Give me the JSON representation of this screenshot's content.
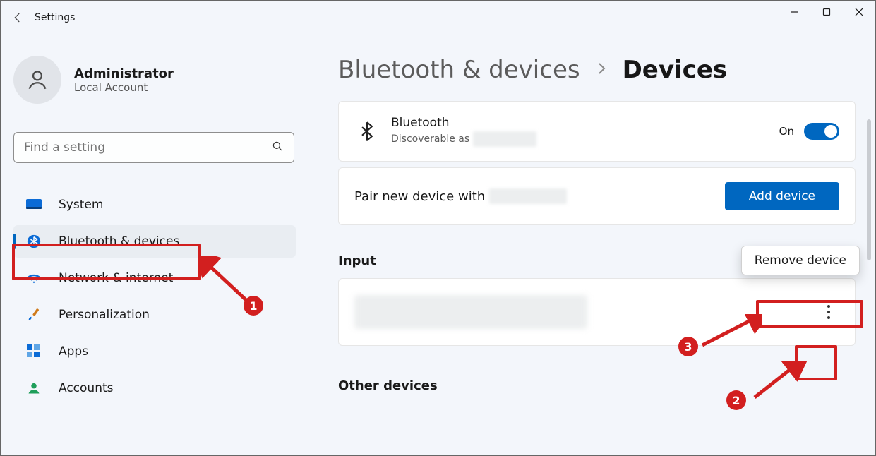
{
  "window": {
    "app_title": "Settings"
  },
  "account": {
    "name": "Administrator",
    "sub": "Local Account"
  },
  "search": {
    "placeholder": "Find a setting"
  },
  "nav": {
    "items": [
      {
        "label": "System"
      },
      {
        "label": "Bluetooth & devices"
      },
      {
        "label": "Network & internet"
      },
      {
        "label": "Personalization"
      },
      {
        "label": "Apps"
      },
      {
        "label": "Accounts"
      }
    ]
  },
  "breadcrumb": {
    "parent": "Bluetooth & devices",
    "current": "Devices"
  },
  "bluetooth": {
    "title": "Bluetooth",
    "subtitle_prefix": "Discoverable as ",
    "toggle_label": "On"
  },
  "pair": {
    "text_prefix": "Pair new device with ",
    "button": "Add device"
  },
  "sections": {
    "input_heading": "Input",
    "other_heading": "Other devices"
  },
  "context_menu": {
    "remove_label": "Remove device"
  },
  "annotations": {
    "badge1": "1",
    "badge2": "2",
    "badge3": "3"
  }
}
